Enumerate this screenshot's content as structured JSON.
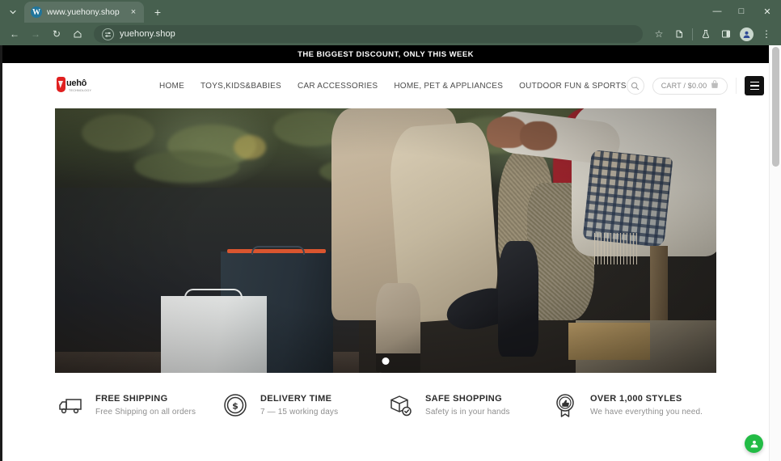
{
  "browser": {
    "tab": {
      "title": "www.yuehony.shop",
      "favicon": "wordpress-icon",
      "close": "×"
    },
    "new_tab": "+",
    "tab_list": "⌄",
    "window_controls": {
      "minimize": "—",
      "maximize": "□",
      "close": "✕"
    },
    "nav": {
      "back": "←",
      "forward": "→",
      "reload": "↻",
      "home": "⌂"
    },
    "omnibox": {
      "url": "yuehony.shop",
      "site_settings_icon": "tune-icon"
    },
    "toolbar_right": {
      "bookmark": "☆",
      "extensions": "extensions-icon",
      "labs": "flask-icon",
      "split": "side-panel-icon",
      "profile": "●",
      "menu": "⋮"
    }
  },
  "site": {
    "announcement": "THE BIGGEST DISCOUNT, ONLY THIS WEEK",
    "logo": {
      "text": "uehô",
      "subtext": "TECHNOLOGY"
    },
    "nav_items": [
      {
        "label": "HOME"
      },
      {
        "label": "TOYS,KIDS&BABIES"
      },
      {
        "label": "CAR ACCESSORIES"
      },
      {
        "label": "HOME, PET & APPLIANCES"
      },
      {
        "label": "OUTDOOR FUN & SPORTS"
      }
    ],
    "header_actions": {
      "search": "search-icon",
      "cart_label": "CART / $0.00",
      "cart_icon": "cart-icon",
      "menu_toggle": "hamburger-icon"
    },
    "hero": {
      "slide_indicator_count": 1,
      "active_slide": 1
    },
    "features": [
      {
        "icon": "truck-icon",
        "title": "FREE SHIPPING",
        "subtitle": "Free Shipping on all orders"
      },
      {
        "icon": "coin-dollar-icon",
        "title": "DELIVERY TIME",
        "subtitle": "7 — 15 working days"
      },
      {
        "icon": "package-check-icon",
        "title": "SAFE SHOPPING",
        "subtitle": "Safety is in your hands"
      },
      {
        "icon": "thumbs-up-badge-icon",
        "title": "OVER 1,000 STYLES",
        "subtitle": "We have everything you need."
      }
    ],
    "floating_widget": {
      "icon": "whatsapp-icon",
      "color": "#22bb45"
    }
  },
  "colors": {
    "browser_chrome": "#47604f",
    "announcement_bg": "#000000",
    "accent_red": "#e02020",
    "widget_green": "#22bb45"
  }
}
